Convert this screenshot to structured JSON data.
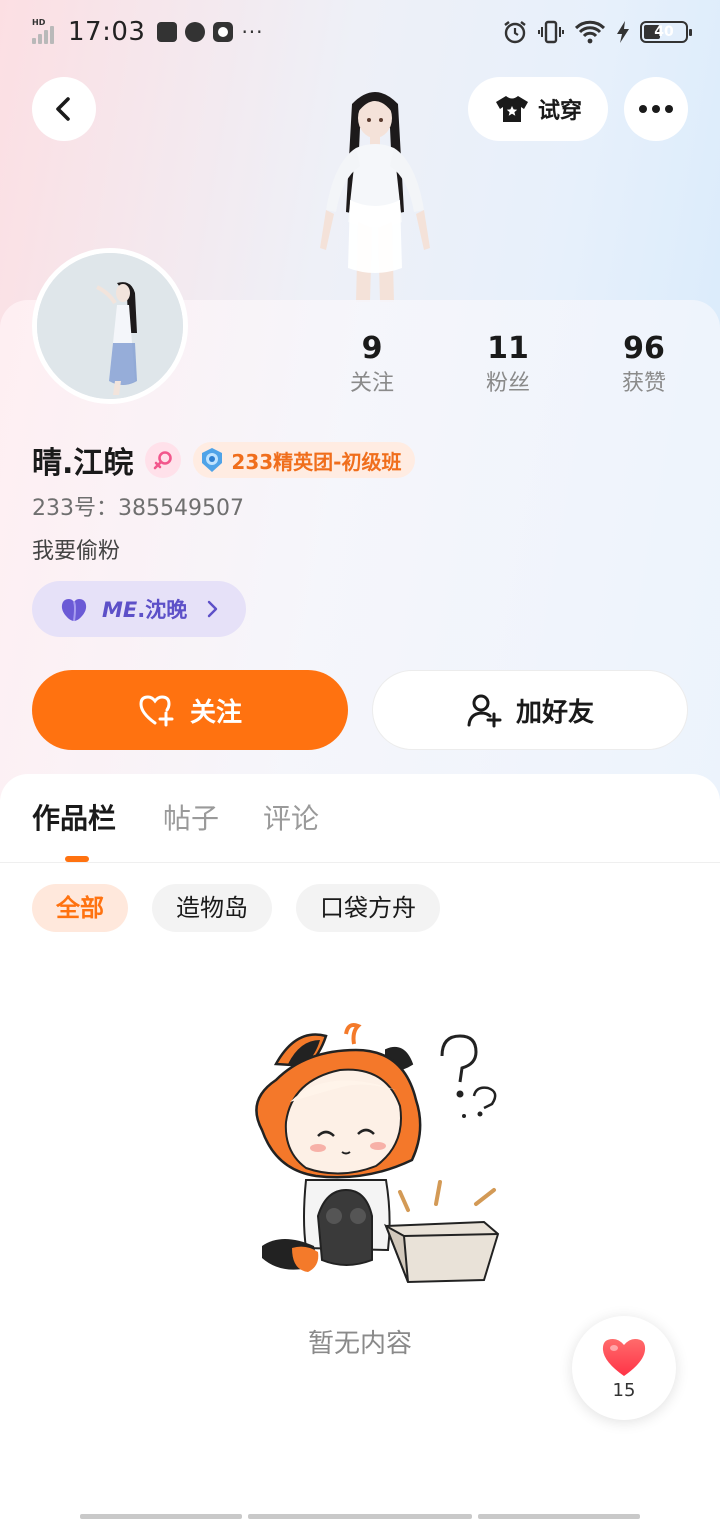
{
  "status_bar": {
    "time": "17:03",
    "network_badge": "HD",
    "battery": "40",
    "battery_level": 0.4,
    "overflow": "···"
  },
  "header": {
    "try_on_label": "试穿",
    "back_icon": "chevron-left-icon",
    "more_icon": "more-dots-icon",
    "try_on_icon": "tshirt-icon"
  },
  "profile": {
    "username": "晴.江皖",
    "gender_icon": "female-icon",
    "rank_badge": "233精英团-初级班",
    "uid": "233号：385549507",
    "bio": "我要偷粉",
    "me_label_bold": "ME",
    "me_label_rest": ".沈晚",
    "stats": [
      {
        "num": "9",
        "label": "关注"
      },
      {
        "num": "11",
        "label": "粉丝"
      },
      {
        "num": "96",
        "label": "获赞"
      }
    ]
  },
  "actions": {
    "follow_label": "关注",
    "add_friend_label": "加好友"
  },
  "tabs": [
    {
      "label": "作品栏",
      "active": true
    },
    {
      "label": "帖子",
      "active": false
    },
    {
      "label": "评论",
      "active": false
    }
  ],
  "filters": [
    {
      "label": "全部",
      "active": true
    },
    {
      "label": "造物岛",
      "active": false
    },
    {
      "label": "口袋方舟",
      "active": false
    }
  ],
  "empty_state": {
    "text": "暂无内容"
  },
  "like_fab": {
    "count": "15"
  },
  "colors": {
    "accent": "#ff7210",
    "me_purple": "#5d50c8",
    "like_red": "#ff4d55"
  }
}
